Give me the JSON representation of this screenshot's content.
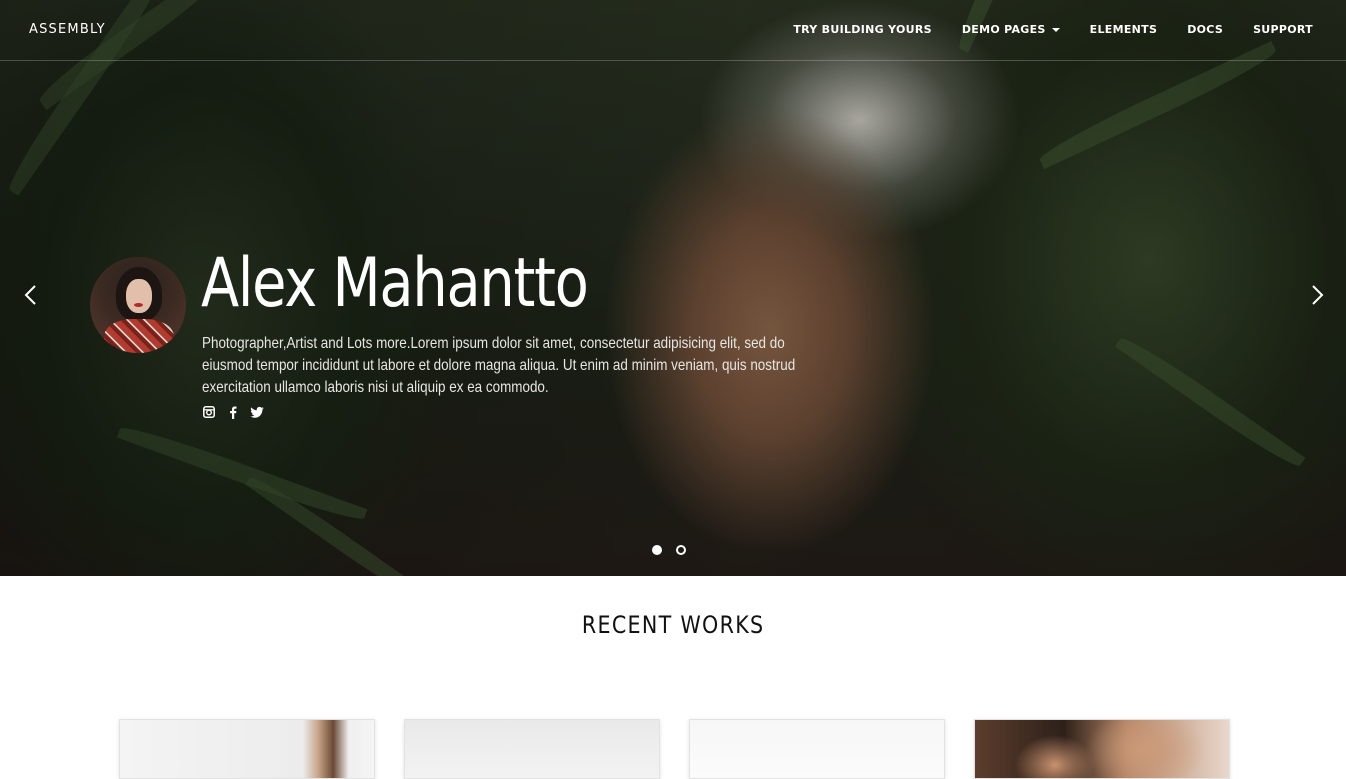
{
  "navbar": {
    "brand": "ASSEMBLY",
    "items": [
      {
        "label": "TRY BUILDING YOURS",
        "dropdown": false
      },
      {
        "label": "DEMO PAGES",
        "dropdown": true
      },
      {
        "label": "ELEMENTS",
        "dropdown": false
      },
      {
        "label": "DOCS",
        "dropdown": false
      },
      {
        "label": "SUPPORT",
        "dropdown": false
      }
    ]
  },
  "hero": {
    "name": "Alex Mahantto",
    "description": "Photographer,Artist and Lots more.Lorem ipsum dolor sit amet, consectetur adipisicing elit, sed do eiusmod tempor incididunt ut labore et dolore magna aliqua. Ut enim ad minim veniam, quis nostrud exercitation ullamco laboris nisi ut aliquip ex ea commodo.",
    "socials": [
      "instagram-icon",
      "facebook-icon",
      "twitter-icon"
    ],
    "carousel": {
      "slides": 2,
      "active_index": 0
    }
  },
  "recent_works": {
    "title": "RECENT WORKS",
    "items": [
      "work-1",
      "work-2",
      "work-3",
      "work-4"
    ]
  },
  "colors": {
    "nav_text": "#ffffff",
    "title_text": "#111111",
    "page_background": "#ffffff"
  }
}
